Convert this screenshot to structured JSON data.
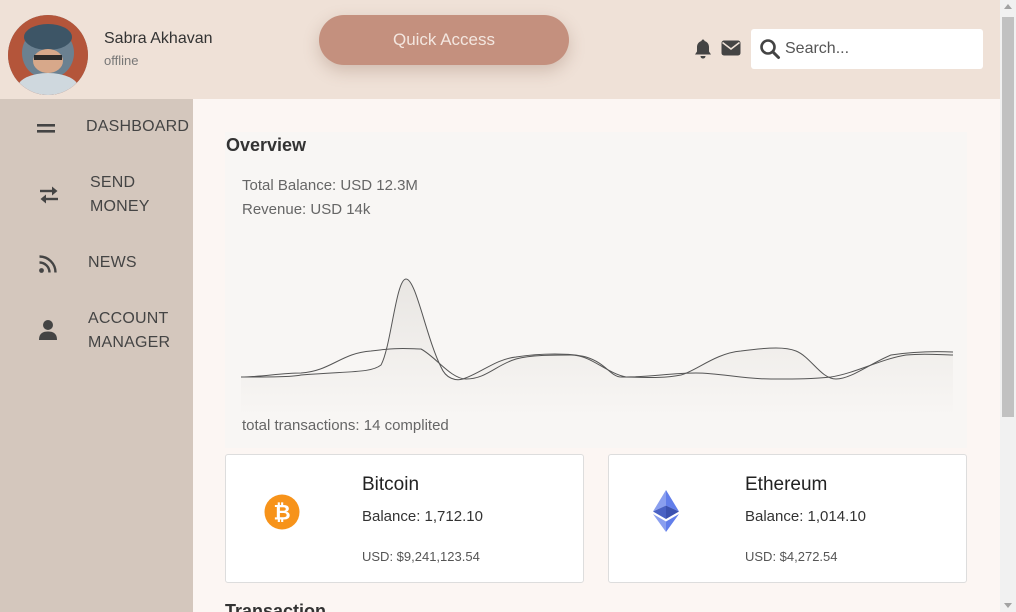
{
  "header": {
    "user_name": "Sabra Akhavan",
    "user_status": "offline",
    "quick_access_label": "Quick Access",
    "search_placeholder": "Search..."
  },
  "sidebar": {
    "items": [
      {
        "label_lines": [
          "DASHBOARD"
        ],
        "icon": "menu-icon"
      },
      {
        "label_lines": [
          "SEND",
          "MONEY"
        ],
        "icon": "exchange-arrows-icon"
      },
      {
        "label_lines": [
          "NEWS"
        ],
        "icon": "rss-icon"
      },
      {
        "label_lines": [
          "ACCOUNT",
          "MANAGER"
        ],
        "icon": "user-icon"
      }
    ]
  },
  "overview": {
    "title": "Overview",
    "total_balance": "Total Balance: USD 12.3M",
    "revenue": "Revenue: USD 14k",
    "transactions": "total transactions: 14 complited"
  },
  "cards": [
    {
      "name": "Bitcoin",
      "balance": "Balance: 1,712.10",
      "usd": "USD: $9,241,123.54",
      "icon": "bitcoin-icon",
      "color": "#f7931a"
    },
    {
      "name": "Ethereum",
      "balance": "Balance: 1,014.10",
      "usd": "USD: $4,272.54",
      "icon": "ethereum-icon",
      "color": "#627eea"
    }
  ],
  "next_section_title": "Transaction",
  "colors": {
    "header_bg": "#efe1d7",
    "sidebar_bg": "#d4c7bd",
    "quick_access_bg": "#c4907e",
    "main_bg": "#fcf6f3"
  }
}
